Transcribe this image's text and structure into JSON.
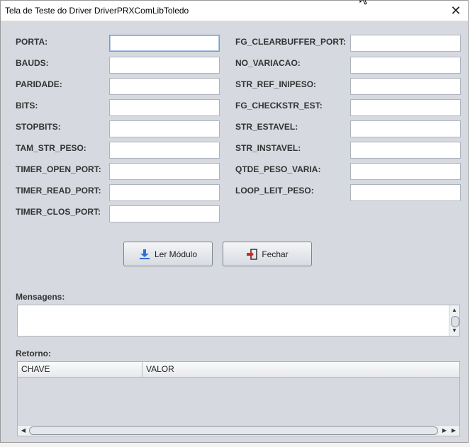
{
  "window": {
    "title": "Tela de Teste do Driver DriverPRXComLibToledo",
    "close_glyph": "✕"
  },
  "left_fields": [
    {
      "label": "PORTA:",
      "value": ""
    },
    {
      "label": "BAUDS:",
      "value": ""
    },
    {
      "label": "PARIDADE:",
      "value": ""
    },
    {
      "label": "BITS:",
      "value": ""
    },
    {
      "label": "STOPBITS:",
      "value": ""
    },
    {
      "label": "TAM_STR_PESO:",
      "value": ""
    },
    {
      "label": "TIMER_OPEN_PORT:",
      "value": ""
    },
    {
      "label": "TIMER_READ_PORT:",
      "value": ""
    },
    {
      "label": "TIMER_CLOS_PORT:",
      "value": ""
    }
  ],
  "right_fields": [
    {
      "label": "FG_CLEARBUFFER_PORT:",
      "value": ""
    },
    {
      "label": "NO_VARIACAO:",
      "value": ""
    },
    {
      "label": "STR_REF_INIPESO:",
      "value": ""
    },
    {
      "label": "FG_CHECKSTR_EST:",
      "value": ""
    },
    {
      "label": "STR_ESTAVEL:",
      "value": ""
    },
    {
      "label": "STR_INSTAVEL:",
      "value": ""
    },
    {
      "label": "QTDE_PESO_VARIA:",
      "value": ""
    },
    {
      "label": "LOOP_LEIT_PESO:",
      "value": ""
    }
  ],
  "buttons": {
    "read_label": "Ler Módulo",
    "close_label": "Fechar"
  },
  "messages": {
    "label": "Mensagens:",
    "value": ""
  },
  "return_section": {
    "label": "Retorno:",
    "columns": [
      "CHAVE",
      "VALOR"
    ]
  },
  "colors": {
    "window_bg": "#d6d9df",
    "field_border": "#aeb4be",
    "focus_border": "#7a9cc6",
    "download_icon_blue": "#2f6fd0",
    "exit_icon_red": "#c0302a"
  }
}
